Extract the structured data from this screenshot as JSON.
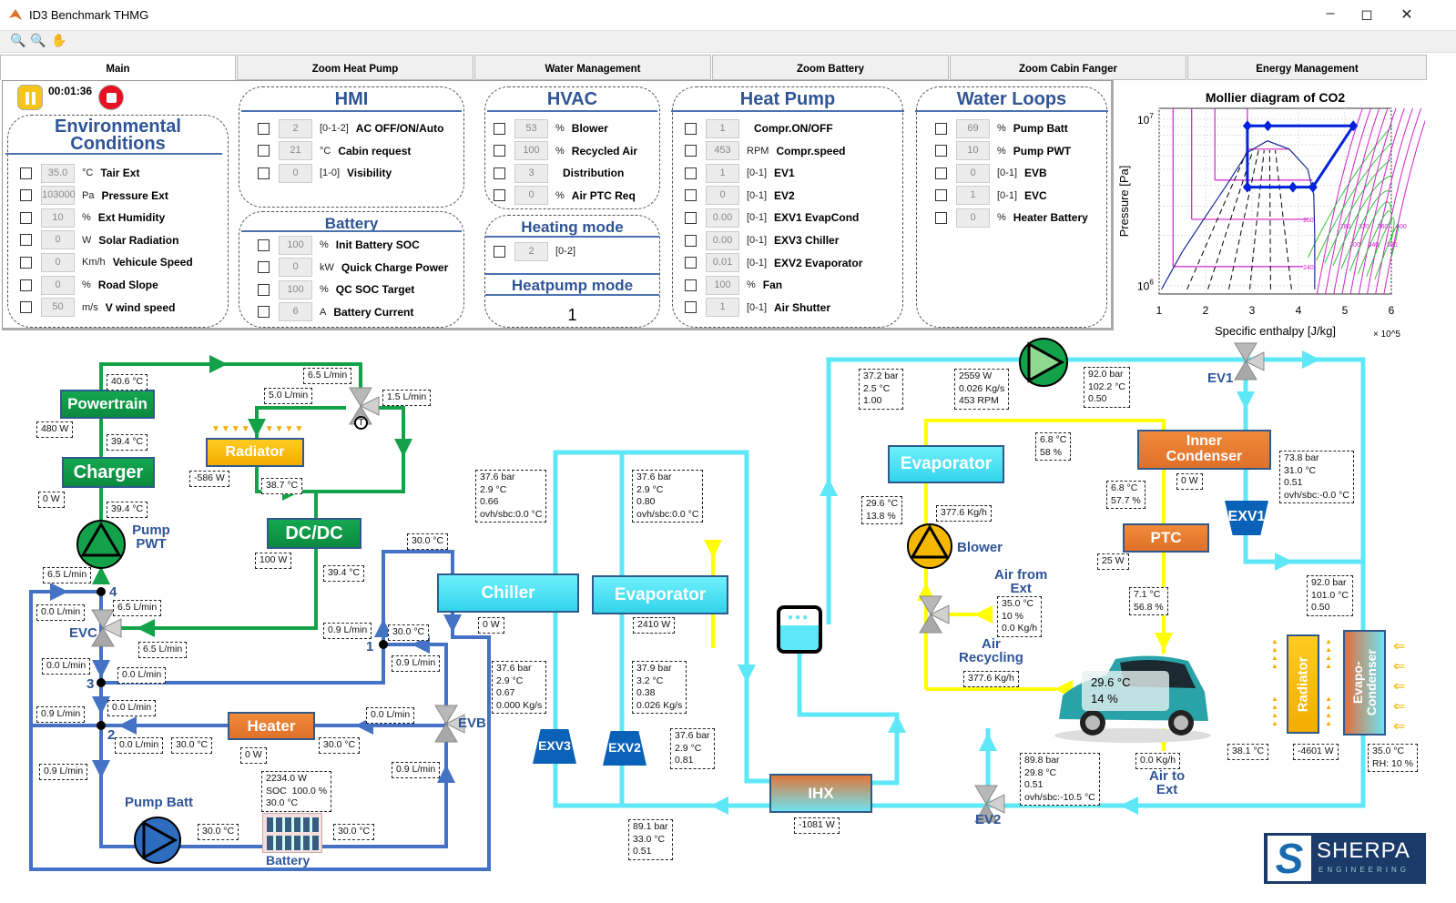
{
  "window": {
    "title": "ID3  Benchmark THMG",
    "icon": "matlab-icon",
    "buttons": [
      "minimize-icon",
      "maximize-icon",
      "close-icon"
    ]
  },
  "toolbar": {
    "icons": [
      "zoom-in-icon",
      "zoom-out-icon",
      "pan-icon"
    ]
  },
  "tabs": [
    {
      "label": "Main",
      "active": true
    },
    {
      "label": "Zoom Heat Pump",
      "active": false
    },
    {
      "label": "Water Management",
      "active": false
    },
    {
      "label": "Zoom Battery",
      "active": false
    },
    {
      "label": "Zoom Cabin Fanger",
      "active": false
    },
    {
      "label": "Energy Management",
      "active": false
    }
  ],
  "controls": {
    "timer": "00:01:36",
    "pause_icon": "pause-icon",
    "stop_icon": "stop-icon",
    "pause_color": "#f5c518",
    "stop_color": "#e81123"
  },
  "panels": {
    "environment": {
      "title": "Environmental Conditions",
      "rows": [
        {
          "value": "35.0",
          "unit": "°C",
          "label": "Tair Ext"
        },
        {
          "value": "103000",
          "unit": "Pa",
          "label": "Pressure Ext"
        },
        {
          "value": "10",
          "unit": "%",
          "label": "Ext Humidity"
        },
        {
          "value": "0",
          "unit": "W",
          "label": "Solar Radiation"
        },
        {
          "value": "0",
          "unit": "Km/h",
          "label": "Vehicule Speed"
        },
        {
          "value": "0",
          "unit": "%",
          "label": "Road Slope"
        },
        {
          "value": "50",
          "unit": "m/s",
          "label": "V wind speed"
        }
      ]
    },
    "hmi": {
      "title": "HMI",
      "rows": [
        {
          "value": "2",
          "unit": "[0-1-2]",
          "label": "AC OFF/ON/Auto"
        },
        {
          "value": "21",
          "unit": "°C",
          "label": "Cabin request"
        },
        {
          "value": "0",
          "unit": "[1-0]",
          "label": "Visibility"
        }
      ]
    },
    "battery": {
      "title": "Battery",
      "rows": [
        {
          "value": "100",
          "unit": "%",
          "label": "Init Battery SOC"
        },
        {
          "value": "0",
          "unit": "kW",
          "label": "Quick Charge Power"
        },
        {
          "value": "100",
          "unit": "%",
          "label": "QC SOC Target"
        },
        {
          "value": "6",
          "unit": "A",
          "label": "Battery Current"
        }
      ]
    },
    "hvac": {
      "title": "HVAC",
      "rows": [
        {
          "value": "53",
          "unit": "%",
          "label": "Blower"
        },
        {
          "value": "100",
          "unit": "%",
          "label": "Recycled Air"
        },
        {
          "value": "3",
          "unit": "",
          "label": "Distribution"
        },
        {
          "value": "0",
          "unit": "%",
          "label": "Air PTC Req"
        }
      ]
    },
    "heating_mode": {
      "title": "Heating mode",
      "rows": [
        {
          "value": "2",
          "unit": "[0-2]",
          "label": ""
        }
      ]
    },
    "heatpump_mode": {
      "title": "Heatpump mode",
      "value": "1"
    },
    "heat_pump": {
      "title": "Heat Pump",
      "rows": [
        {
          "value": "1",
          "unit": "",
          "label": "Compr.ON/OFF"
        },
        {
          "value": "453",
          "unit": "RPM",
          "label": "Compr.speed"
        },
        {
          "value": "1",
          "unit": "[0-1]",
          "label": "EV1"
        },
        {
          "value": "0",
          "unit": "[0-1]",
          "label": "EV2"
        },
        {
          "value": "0.00",
          "unit": "[0-1]",
          "label": "EXV1 EvapCond"
        },
        {
          "value": "0.00",
          "unit": "[0-1]",
          "label": "EXV3 Chiller"
        },
        {
          "value": "0.01",
          "unit": "[0-1]",
          "label": "EXV2 Evaporator"
        },
        {
          "value": "100",
          "unit": "%",
          "label": "Fan"
        },
        {
          "value": "1",
          "unit": "[0-1]",
          "label": "Air Shutter"
        }
      ]
    },
    "water_loops": {
      "title": "Water Loops",
      "rows": [
        {
          "value": "69",
          "unit": "%",
          "label": "Pump Batt"
        },
        {
          "value": "10",
          "unit": "%",
          "label": "Pump PWT"
        },
        {
          "value": "0",
          "unit": "[0-1]",
          "label": "EVB"
        },
        {
          "value": "1",
          "unit": "[0-1]",
          "label": "EVC"
        },
        {
          "value": "0",
          "unit": "%",
          "label": "Heater Battery"
        }
      ]
    }
  },
  "chart_data": {
    "type": "line",
    "title": "Mollier diagram of CO2",
    "xlabel": "Specific enthalpy [J/kg]",
    "x_multiplier": "× 10^5",
    "ylabel": "Pressure [Pa]",
    "xlim": [
      100000,
      600000
    ],
    "ylim": [
      890000,
      11600000
    ],
    "yscale": "log",
    "x_ticks": [
      "1",
      "2",
      "3",
      "4",
      "5",
      "6"
    ],
    "y_ticks": [
      {
        "base": "10",
        "exp": "6"
      },
      {
        "base": "10",
        "exp": "7"
      }
    ],
    "grid": true,
    "cycle": {
      "color": "#0022dd",
      "points": [
        {
          "h": 290000,
          "p": 9100000
        },
        {
          "h": 334000,
          "p": 9100000
        },
        {
          "h": 518000,
          "p": 9100000
        },
        {
          "h": 431000,
          "p": 3900000
        },
        {
          "h": 388000,
          "p": 3900000
        },
        {
          "h": 290000,
          "p": 3900000
        }
      ]
    },
    "saturation_curve": {
      "color": "#1a2a99",
      "points": [
        {
          "h": 105000,
          "p": 950000
        },
        {
          "h": 150000,
          "p": 1600000
        },
        {
          "h": 200000,
          "p": 2600000
        },
        {
          "h": 250000,
          "p": 4200000
        },
        {
          "h": 290000,
          "p": 6300000
        },
        {
          "h": 333000,
          "p": 7400000
        },
        {
          "h": 380000,
          "p": 6600000
        },
        {
          "h": 420000,
          "p": 5000000
        },
        {
          "h": 433000,
          "p": 3500000
        },
        {
          "h": 435000,
          "p": 2000000
        },
        {
          "h": 435000,
          "p": 950000
        }
      ]
    },
    "isotherm_labels": [
      "240",
      "260",
      "280",
      "300",
      "320",
      "340",
      "360",
      "380",
      "400"
    ],
    "isotherm_color": "#d020c8",
    "isentrope_color": "#30c040"
  },
  "diagram": {
    "components": {
      "powertrain": "Powertrain",
      "charger": "Charger",
      "radiator_pwt": "Radiator",
      "dcdc": "DC/DC",
      "pump_pwt": "Pump\nPWT",
      "evc": "EVC",
      "evb": "EVB",
      "heater": "Heater",
      "pump_batt": "Pump Batt",
      "battery": "Battery",
      "chiller": "Chiller",
      "evaporator_ref": "Evaporator",
      "exv3": "EXV3",
      "exv2": "EXV2",
      "ihx": "IHX",
      "ev1": "EV1",
      "ev2": "EV2",
      "exv1": "EXV1",
      "evaporator_air": "Evaporator",
      "inner_condenser": "Inner\nCondenser",
      "ptc": "PTC",
      "blower": "Blower",
      "air_from_ext": "Air from\nExt",
      "air_recycling": "Air\nRecycling",
      "air_to_ext": "Air to\nExt",
      "radiator_front": "Radiator",
      "evapo_condenser": "Evapo-\nCondenser",
      "node1": "1",
      "node2": "2",
      "node3": "3",
      "node4": "4",
      "thermostat": "T"
    },
    "cabin": {
      "temperature": "29.6 °C",
      "humidity": "14 %"
    },
    "values": [
      "40.6 °C",
      "480 W",
      "39.4 °C",
      "0 W",
      "39.4 °C",
      "6.5 L/min",
      "5.0 L/min",
      "1.5 L/min",
      "-586 W",
      "38.7 °C",
      "100 W",
      "39.4 °C",
      "30.0 °C",
      "6.5 L/min",
      "6.5 L/min",
      "0.0 L/min",
      "6.5 L/min",
      "0.0 L/min",
      "0.0 L/min",
      "0.9 L/min",
      "30.0 °C",
      "0.9 L/min",
      "0.0 L/min",
      "0.9 L/min",
      "0.0 L/min",
      "30.0 °C",
      "0.0 L/min",
      "30.0 °C",
      "0 W",
      "0.9 L/min",
      "0.9 L/min",
      "2234.0 W\nSOC  100.0 %\n30.0 °C",
      "30.0 °C",
      "30.0 °C",
      "37.6 bar\n2.9 °C\n0.66\novh/sbc:0.0 °C",
      "37.6 bar\n2.9 °C\n0.80\novh/sbc:0.0 °C",
      "0 W",
      "2410 W",
      "37.6 bar\n2.9 °C\n0.67\n0.000 Kg/s",
      "37.9 bar\n3.2 °C\n0.38\n0.026 Kg/s",
      "37.6 bar\n2.9 °C\n0.81",
      "89.1 bar\n33.0 °C\n0.51",
      "-1081 W",
      "37.2 bar\n2.5 °C\n1.00",
      "2559 W\n0.026 Kg/s\n453 RPM",
      "92.0 bar\n102.2 °C\n0.50",
      "6.8 °C\n58 %",
      "29.6 °C\n13.8 %",
      "377.6 Kg/h",
      "6.8 °C\n57.7 %",
      "0 W",
      "73.8 bar\n31.0 °C\n0.51\novh/sbc:-0.0 °C",
      "25 W",
      "7.1 °C\n56.8 %",
      "35.0 °C\n10 %\n0.0 Kg/h",
      "377.6 Kg/h",
      "92.0 bar\n101.0 °C\n0.50",
      "89.8 bar\n29.8 °C\n0.51\novh/sbc:-10.5 °C",
      "0.0 Kg/h",
      "38.1 °C",
      "-4601 W",
      "35.0 °C\nRH: 10 %"
    ],
    "colors": {
      "coolant_pwt": "#13a24a",
      "coolant_batt": "#4472c4",
      "refrigerant": "#5ee8f7",
      "air": "#ffff00"
    }
  },
  "logo": {
    "name": "SHERPA",
    "sub": "ENGINEERING"
  }
}
